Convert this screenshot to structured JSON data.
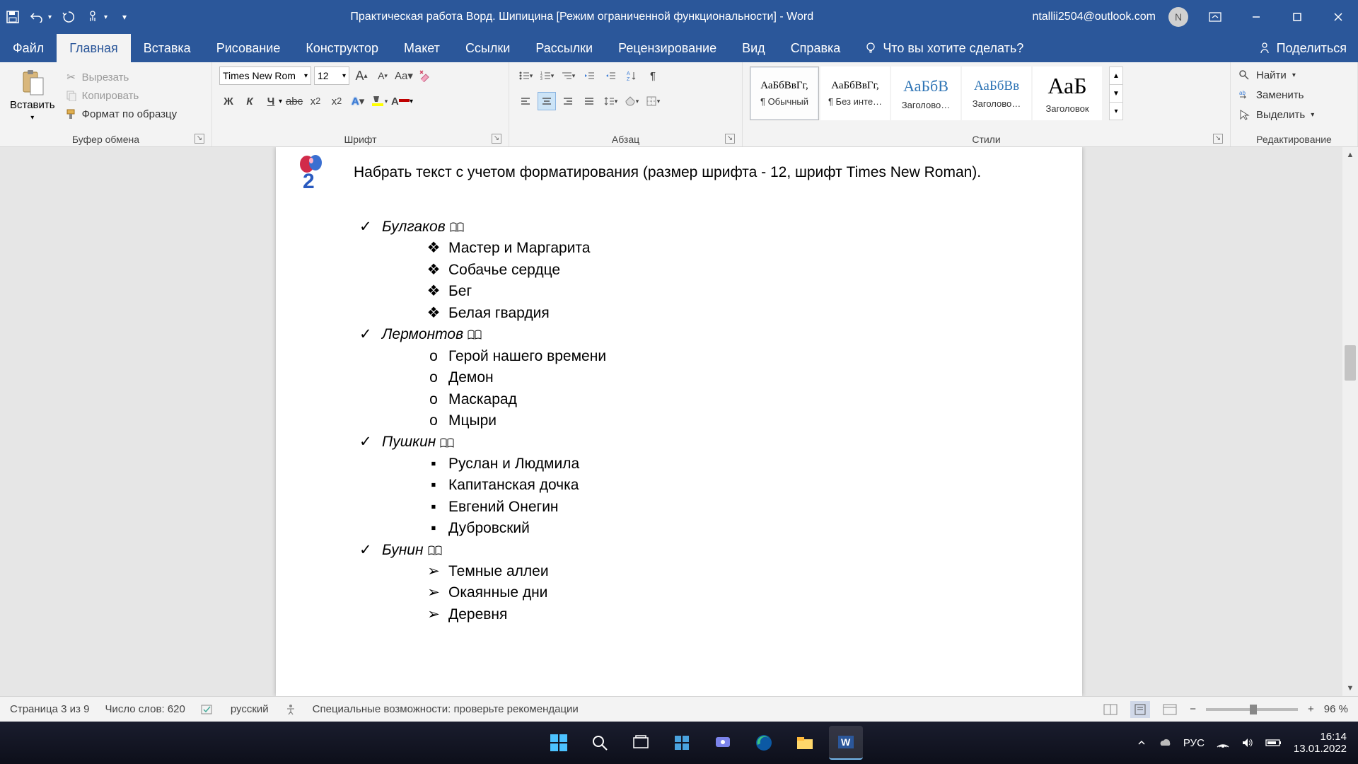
{
  "title": "Практическая работа Ворд. Шипицина [Режим ограниченной функциональности]  -  Word",
  "user_email": "ntallii2504@outlook.com",
  "avatar_initial": "N",
  "tabs": {
    "file": "Файл",
    "home": "Главная",
    "insert": "Вставка",
    "draw": "Рисование",
    "design": "Конструктор",
    "layout": "Макет",
    "references": "Ссылки",
    "mailings": "Рассылки",
    "review": "Рецензирование",
    "view": "Вид",
    "help": "Справка",
    "tell_me": "Что вы хотите сделать?",
    "share": "Поделиться"
  },
  "ribbon": {
    "clipboard": {
      "paste": "Вставить",
      "cut": "Вырезать",
      "copy": "Копировать",
      "format_painter": "Формат по образцу",
      "label": "Буфер обмена"
    },
    "font": {
      "name": "Times New Rom",
      "size": "12",
      "bold": "Ж",
      "italic": "К",
      "underline": "Ч",
      "label": "Шрифт"
    },
    "paragraph": {
      "label": "Абзац"
    },
    "styles": {
      "label": "Стили",
      "items": [
        {
          "preview": "АаБбВвГг,",
          "name": "¶ Обычный",
          "size": "15px",
          "selected": true
        },
        {
          "preview": "АаБбВвГг,",
          "name": "¶ Без инте…",
          "size": "15px"
        },
        {
          "preview": "АаБбВ",
          "name": "Заголово…",
          "size": "22px",
          "color": "#2e74b5"
        },
        {
          "preview": "АаБбВв",
          "name": "Заголово…",
          "size": "19px",
          "color": "#2e74b5"
        },
        {
          "preview": "АаБ",
          "name": "Заголовок",
          "size": "32px"
        }
      ]
    },
    "editing": {
      "find": "Найти",
      "replace": "Заменить",
      "select": "Выделить",
      "label": "Редактирование"
    }
  },
  "document": {
    "task": "Набрать текст с учетом форматирования (размер шрифта - 12, шрифт Times New Roman).",
    "authors": [
      {
        "name": "Булгаков",
        "bullet": "❖",
        "works": [
          "Мастер и Маргарита",
          "Собачье сердце",
          "Бег",
          "Белая гвардия"
        ]
      },
      {
        "name": "Лермонтов",
        "bullet": "o",
        "works": [
          "Герой нашего времени",
          "Демон",
          "Маскарад",
          "Мцыри"
        ]
      },
      {
        "name": "Пушкин",
        "bullet": "▪",
        "works": [
          "Руслан и Людмила",
          "Капитанская дочка",
          "Евгений Онегин",
          "Дубровский"
        ]
      },
      {
        "name": "Бунин",
        "bullet": "➢",
        "works": [
          "Темные аллеи",
          "Окаянные дни",
          "Деревня"
        ]
      }
    ]
  },
  "status": {
    "page": "Страница 3 из 9",
    "words": "Число слов: 620",
    "language": "русский",
    "accessibility": "Специальные возможности: проверьте рекомендации",
    "zoom": "96 %"
  },
  "taskbar": {
    "lang": "РУС",
    "time": "16:14",
    "date": "13.01.2022"
  }
}
